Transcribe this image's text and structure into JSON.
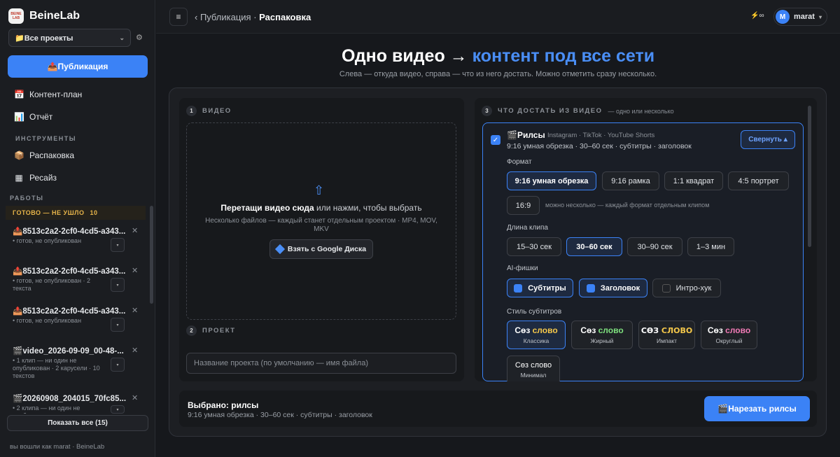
{
  "brand": {
    "logo_text": "BEINE LAB",
    "name": "BeineLab"
  },
  "sidebar": {
    "project_select": "📁Все проекты",
    "publish_button": "📤Публикация",
    "nav": [
      {
        "icon": "📅",
        "label": "Контент-план"
      },
      {
        "icon": "📊",
        "label": "Отчёт"
      }
    ],
    "tools_label": "ИНСТРУМЕНТЫ",
    "tools": [
      {
        "icon": "📦",
        "label": "Распаковка"
      },
      {
        "icon": "▦",
        "label": "Ресайз"
      }
    ],
    "jobs_label": "РАБОТЫ",
    "ready_label": "ГОТОВО — НЕ УШЛО",
    "ready_count": "10",
    "jobs": [
      {
        "icon": "📤",
        "title": "8513c2a2-2cf0-4cd5-a343...",
        "meta": "• готов, не опубликован"
      },
      {
        "icon": "📤",
        "title": "8513c2a2-2cf0-4cd5-a343...",
        "meta": "• готов, не опубликован · 2 текста"
      },
      {
        "icon": "📤",
        "title": "8513c2a2-2cf0-4cd5-a343...",
        "meta": "• готов, не опубликован"
      },
      {
        "icon": "🎬",
        "title": "video_2026-09-09_00-48-...",
        "meta": "• 1 клип — ни один не опубликован · 2 карусели · 10 текстов"
      },
      {
        "icon": "🎬",
        "title": "20260908_204015_70fc85...",
        "meta": "• 2 клипа — ни один не опубликован"
      }
    ],
    "show_all": "Показать все (15)",
    "footer": "вы вошли как marat · BeineLab"
  },
  "topbar": {
    "back": "‹ Публикация · ",
    "current": "Распаковка",
    "credits": "⚡∞",
    "user_initial": "M",
    "user_name": "marat"
  },
  "hero": {
    "title_start": "Одно видео → ",
    "title_accent": "контент под все сети",
    "subtitle": "Слева — откуда видео, справа — что из него достать. Можно отметить сразу несколько."
  },
  "left": {
    "step1_n": "1",
    "step1_label": "ВИДЕО",
    "drop_strong": "Перетащи видео сюда",
    "drop_rest": " или нажми, чтобы выбрать",
    "drop_sub": "Несколько файлов — каждый станет отдельным проектом · MP4, MOV, MKV",
    "gdrive": "Взять с Google Диска",
    "step2_n": "2",
    "step2_label": "ПРОЕКТ",
    "project_placeholder": "Название проекта (по умолчанию — имя файла)"
  },
  "right": {
    "step3_n": "3",
    "step3_label": "ЧТО ДОСТАТЬ ИЗ ВИДЕО",
    "step3_hint": "— одно или несколько",
    "card_title": "🎬Рилсы",
    "platforms": "Instagram · TikTok · YouTube Shorts",
    "summary": "9:16 умная обрезка · 30–60 сек · субтитры · заголовок",
    "collapse": "Свернуть ▴",
    "format_label": "Формат",
    "formats": [
      "9:16 умная обрезка",
      "9:16 рамка",
      "1:1 квадрат",
      "4:5 портрет",
      "16:9"
    ],
    "format_note": "можно несколько — каждый формат отдельным клипом",
    "length_label": "Длина клипа",
    "lengths": [
      "15–30 сек",
      "30–60 сек",
      "30–90 сек",
      "1–3 мин"
    ],
    "ai_label": "AI-фишки",
    "ai": [
      "Субтитры",
      "Заголовок",
      "Интро-хук"
    ],
    "style_label": "Стиль субтитров",
    "styles": [
      {
        "w1": "Сөз ",
        "w2": "слово",
        "name": "Классика",
        "color": "#f5c84a"
      },
      {
        "w1": "Сөз ",
        "w2": "слово",
        "name": "Жирный",
        "color": "#7ee07e"
      },
      {
        "w1": "СӨЗ ",
        "w2": "СЛОВО",
        "name": "Импакт",
        "color": "#f5c84a"
      },
      {
        "w1": "Сөз ",
        "w2": "слово",
        "name": "Округлый",
        "color": "#f07ab5"
      },
      {
        "w1": "Сөз ",
        "w2": "слово",
        "name": "Минимал",
        "color": "#ffffff"
      }
    ]
  },
  "bottom": {
    "selected": "Выбрано: рилсы",
    "summary": "9:16 умная обрезка · 30–60 сек · субтитры · заголовок",
    "cut_button": "🎬Нарезать рилсы"
  },
  "colors": {
    "accent": "#3b82f6",
    "bg": "#16181c",
    "warn": "#e8b54a"
  }
}
